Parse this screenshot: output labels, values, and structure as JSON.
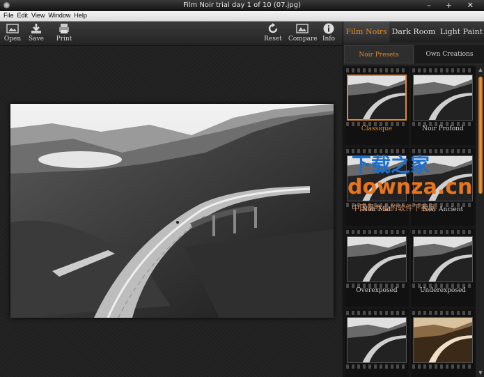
{
  "window": {
    "title": "Film Noir trial day 1 of 10 (07.jpg)",
    "controls": "– + ✕"
  },
  "menu": [
    "File",
    "Edit",
    "View",
    "Window",
    "Help"
  ],
  "toolbar": {
    "open": "Open",
    "save": "Save",
    "print": "Print",
    "reset": "Reset",
    "compare": "Compare",
    "info": "Info"
  },
  "tabs": [
    "Film Noirs",
    "Dark Room",
    "Light Paint"
  ],
  "subtabs": [
    "Noir Presets",
    "Own Creations"
  ],
  "presets": [
    {
      "name": "Classique",
      "tone": "gray"
    },
    {
      "name": "Noir Profond",
      "tone": "gray"
    },
    {
      "name": "Noir Mat",
      "tone": "gray"
    },
    {
      "name": "Noir Ancient",
      "tone": "gray"
    },
    {
      "name": "Overexposed",
      "tone": "gray"
    },
    {
      "name": "Underexposed",
      "tone": "gray"
    },
    {
      "name": "",
      "tone": "gray"
    },
    {
      "name": "",
      "tone": "sepia"
    }
  ],
  "selected_preset": "Classique",
  "watermark": {
    "title": "下载之家",
    "domain": "downza.cn",
    "tagline": "中国最专业的软件下载网"
  },
  "colors": {
    "accent": "#e08a2e",
    "panel": "#262626",
    "canvas": "#202020"
  },
  "icons": [
    "open-icon",
    "save-icon",
    "print-icon",
    "reset-icon",
    "compare-icon",
    "info-icon"
  ]
}
